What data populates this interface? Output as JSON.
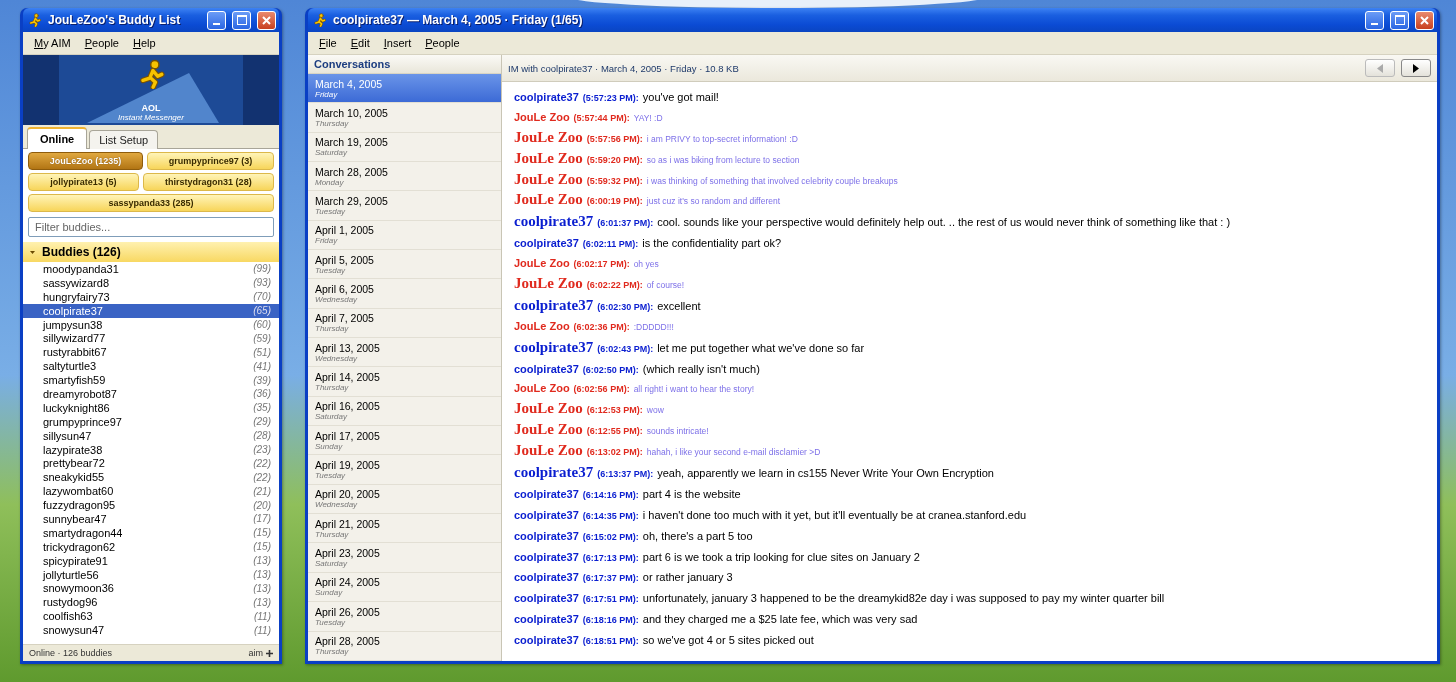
{
  "buddy_window": {
    "title": "JouLeZoo's Buddy List",
    "menu": [
      "My AIM",
      "People",
      "Help"
    ],
    "banner": {
      "brand": "AOL",
      "product": "Instant Messenger"
    },
    "tabs": [
      {
        "label": "Online",
        "selected": true
      },
      {
        "label": "List Setup",
        "selected": false
      }
    ],
    "accounts": [
      {
        "label": "JouLeZoo (1235)",
        "selected": true
      },
      {
        "label": "grumpyprince97 (3)",
        "selected": false
      },
      {
        "label": "jollypirate13 (5)",
        "selected": false
      },
      {
        "label": "thirstydragon31 (28)",
        "selected": false
      },
      {
        "label": "sassypanda33 (285)",
        "selected": false
      }
    ],
    "filter": {
      "placeholder": "Filter buddies..."
    },
    "group": {
      "label": "Buddies (126)",
      "expanded": true,
      "buddies": [
        {
          "name": "moodypanda31",
          "count": "(99)",
          "selected": false
        },
        {
          "name": "sassywizard8",
          "count": "(93)",
          "selected": false
        },
        {
          "name": "hungryfairy73",
          "count": "(70)",
          "selected": false
        },
        {
          "name": "coolpirate37",
          "count": "(65)",
          "selected": true
        },
        {
          "name": "jumpysun38",
          "count": "(60)",
          "selected": false
        },
        {
          "name": "sillywizard77",
          "count": "(59)",
          "selected": false
        },
        {
          "name": "rustyrabbit67",
          "count": "(51)",
          "selected": false
        },
        {
          "name": "saltyturtle3",
          "count": "(41)",
          "selected": false
        },
        {
          "name": "smartyfish59",
          "count": "(39)",
          "selected": false
        },
        {
          "name": "dreamyrobot87",
          "count": "(36)",
          "selected": false
        },
        {
          "name": "luckyknight86",
          "count": "(35)",
          "selected": false
        },
        {
          "name": "grumpyprince97",
          "count": "(29)",
          "selected": false
        },
        {
          "name": "sillysun47",
          "count": "(28)",
          "selected": false
        },
        {
          "name": "lazypirate38",
          "count": "(23)",
          "selected": false
        },
        {
          "name": "prettybear72",
          "count": "(22)",
          "selected": false
        },
        {
          "name": "sneakykid55",
          "count": "(22)",
          "selected": false
        },
        {
          "name": "lazywombat60",
          "count": "(21)",
          "selected": false
        },
        {
          "name": "fuzzydragon95",
          "count": "(20)",
          "selected": false
        },
        {
          "name": "sunnybear47",
          "count": "(17)",
          "selected": false
        },
        {
          "name": "smartydragon44",
          "count": "(15)",
          "selected": false
        },
        {
          "name": "trickydragon62",
          "count": "(15)",
          "selected": false
        },
        {
          "name": "spicypirate91",
          "count": "(13)",
          "selected": false
        },
        {
          "name": "jollyturtle56",
          "count": "(13)",
          "selected": false
        },
        {
          "name": "snowymoon36",
          "count": "(13)",
          "selected": false
        },
        {
          "name": "rustydog96",
          "count": "(13)",
          "selected": false
        },
        {
          "name": "coolfish63",
          "count": "(11)",
          "selected": false
        },
        {
          "name": "snowysun47",
          "count": "(11)",
          "selected": false
        }
      ]
    },
    "status_bar": {
      "text": "Online · 126 buddies",
      "brand": "aim"
    }
  },
  "im_window": {
    "title": "coolpirate37 — March 4, 2005 · Friday (1/65)",
    "menu": [
      "File",
      "Edit",
      "Insert",
      "People"
    ],
    "conversations": {
      "heading": "Conversations",
      "items": [
        {
          "date": "March 4, 2005",
          "day": "Friday",
          "selected": true
        },
        {
          "date": "March 10, 2005",
          "day": "Thursday",
          "selected": false
        },
        {
          "date": "March 19, 2005",
          "day": "Saturday",
          "selected": false
        },
        {
          "date": "March 28, 2005",
          "day": "Monday",
          "selected": false
        },
        {
          "date": "March 29, 2005",
          "day": "Tuesday",
          "selected": false
        },
        {
          "date": "April 1, 2005",
          "day": "Friday",
          "selected": false
        },
        {
          "date": "April 5, 2005",
          "day": "Tuesday",
          "selected": false
        },
        {
          "date": "April 6, 2005",
          "day": "Wednesday",
          "selected": false
        },
        {
          "date": "April 7, 2005",
          "day": "Thursday",
          "selected": false
        },
        {
          "date": "April 13, 2005",
          "day": "Wednesday",
          "selected": false
        },
        {
          "date": "April 14, 2005",
          "day": "Thursday",
          "selected": false
        },
        {
          "date": "April 16, 2005",
          "day": "Saturday",
          "selected": false
        },
        {
          "date": "April 17, 2005",
          "day": "Sunday",
          "selected": false
        },
        {
          "date": "April 19, 2005",
          "day": "Tuesday",
          "selected": false
        },
        {
          "date": "April 20, 2005",
          "day": "Wednesday",
          "selected": false
        },
        {
          "date": "April 21, 2005",
          "day": "Thursday",
          "selected": false
        },
        {
          "date": "April 23, 2005",
          "day": "Saturday",
          "selected": false
        },
        {
          "date": "April 24, 2005",
          "day": "Sunday",
          "selected": false
        },
        {
          "date": "April 26, 2005",
          "day": "Tuesday",
          "selected": false
        },
        {
          "date": "April 28, 2005",
          "day": "Thursday",
          "selected": false
        }
      ]
    },
    "header": {
      "text": "IM with coolpirate37 · March 4, 2005 · Friday · 10.8 KB",
      "prev_button": {
        "disabled": true
      },
      "next_button": {
        "disabled": false
      }
    },
    "messages": [
      {
        "sender": "coolpirate37",
        "time": "(5:57:23 PM):",
        "text": "you've got mail!",
        "outgoing": false,
        "kind": "sans"
      },
      {
        "sender": "JouLe Zoo",
        "time": "(5:57:44 PM):",
        "text": "YAY! :D",
        "outgoing": true,
        "kind": "sans"
      },
      {
        "sender": "JouLe Zoo",
        "time": "(5:57:56 PM):",
        "text": "i am PRIVY to top-secret information! :D",
        "outgoing": true,
        "kind": "serif"
      },
      {
        "sender": "JouLe Zoo",
        "time": "(5:59:20 PM):",
        "text": "so as i was biking from lecture to section",
        "outgoing": true,
        "kind": "serif"
      },
      {
        "sender": "JouLe Zoo",
        "time": "(5:59:32 PM):",
        "text": "i was thinking of something that involved celebrity couple breakups",
        "outgoing": true,
        "kind": "serif"
      },
      {
        "sender": "JouLe Zoo",
        "time": "(6:00:19 PM):",
        "text": "just cuz it's so random and different",
        "outgoing": true,
        "kind": "serif"
      },
      {
        "sender": "coolpirate37",
        "time": "(6:01:37 PM):",
        "text": "cool. sounds like your perspective would definitely help out. .. the rest of us would never think of something like that : )",
        "outgoing": false,
        "kind": "serif"
      },
      {
        "sender": "coolpirate37",
        "time": "(6:02:11 PM):",
        "text": "is the confidentiality part ok?",
        "outgoing": false,
        "kind": "sans"
      },
      {
        "sender": "JouLe Zoo",
        "time": "(6:02:17 PM):",
        "text": "oh yes",
        "outgoing": true,
        "kind": "sans"
      },
      {
        "sender": "JouLe Zoo",
        "time": "(6:02:22 PM):",
        "text": "of course!",
        "outgoing": true,
        "kind": "serif"
      },
      {
        "sender": "coolpirate37",
        "time": "(6:02:30 PM):",
        "text": "excellent",
        "outgoing": false,
        "kind": "serif"
      },
      {
        "sender": "JouLe Zoo",
        "time": "(6:02:36 PM):",
        "text": ":DDDDD!!!",
        "outgoing": true,
        "kind": "sans"
      },
      {
        "sender": "coolpirate37",
        "time": "(6:02:43 PM):",
        "text": "let me put together what we've done so far",
        "outgoing": false,
        "kind": "serif"
      },
      {
        "sender": "coolpirate37",
        "time": "(6:02:50 PM):",
        "text": "(which really isn't much)",
        "outgoing": false,
        "kind": "sans"
      },
      {
        "sender": "JouLe Zoo",
        "time": "(6:02:56 PM):",
        "text": "all right! i want to hear the story!",
        "outgoing": true,
        "kind": "sans"
      },
      {
        "sender": "JouLe Zoo",
        "time": "(6:12:53 PM):",
        "text": "wow",
        "outgoing": true,
        "kind": "serif"
      },
      {
        "sender": "JouLe Zoo",
        "time": "(6:12:55 PM):",
        "text": "sounds intricate!",
        "outgoing": true,
        "kind": "serif"
      },
      {
        "sender": "JouLe Zoo",
        "time": "(6:13:02 PM):",
        "text": "hahah, i like your second e-mail disclamier >D",
        "outgoing": true,
        "kind": "serif"
      },
      {
        "sender": "coolpirate37",
        "time": "(6:13:37 PM):",
        "text": "yeah, apparently we learn in cs155 Never Write Your Own Encryption",
        "outgoing": false,
        "kind": "serif"
      },
      {
        "sender": "coolpirate37",
        "time": "(6:14:16 PM):",
        "text": "part 4 is the website",
        "outgoing": false,
        "kind": "sans"
      },
      {
        "sender": "coolpirate37",
        "time": "(6:14:35 PM):",
        "text": "i haven't done too much with it yet, but it'll eventually be at cranea.stanford.edu",
        "outgoing": false,
        "kind": "sans"
      },
      {
        "sender": "coolpirate37",
        "time": "(6:15:02 PM):",
        "text": "oh, there's a part 5 too",
        "outgoing": false,
        "kind": "sans"
      },
      {
        "sender": "coolpirate37",
        "time": "(6:17:13 PM):",
        "text": "part 6 is we took a trip looking for clue sites on January 2",
        "outgoing": false,
        "kind": "sans"
      },
      {
        "sender": "coolpirate37",
        "time": "(6:17:37 PM):",
        "text": "or rather january 3",
        "outgoing": false,
        "kind": "sans"
      },
      {
        "sender": "coolpirate37",
        "time": "(6:17:51 PM):",
        "text": "unfortunately, january 3 happened to be the dreamykid82e day i was supposed to pay my winter quarter bill",
        "outgoing": false,
        "kind": "sans"
      },
      {
        "sender": "coolpirate37",
        "time": "(6:18:16 PM):",
        "text": "and they charged me a $25 late fee, which was very sad",
        "outgoing": false,
        "kind": "sans"
      },
      {
        "sender": "coolpirate37",
        "time": "(6:18:51 PM):",
        "text": "so we've got 4 or 5 sites picked out",
        "outgoing": false,
        "kind": "sans"
      }
    ]
  }
}
